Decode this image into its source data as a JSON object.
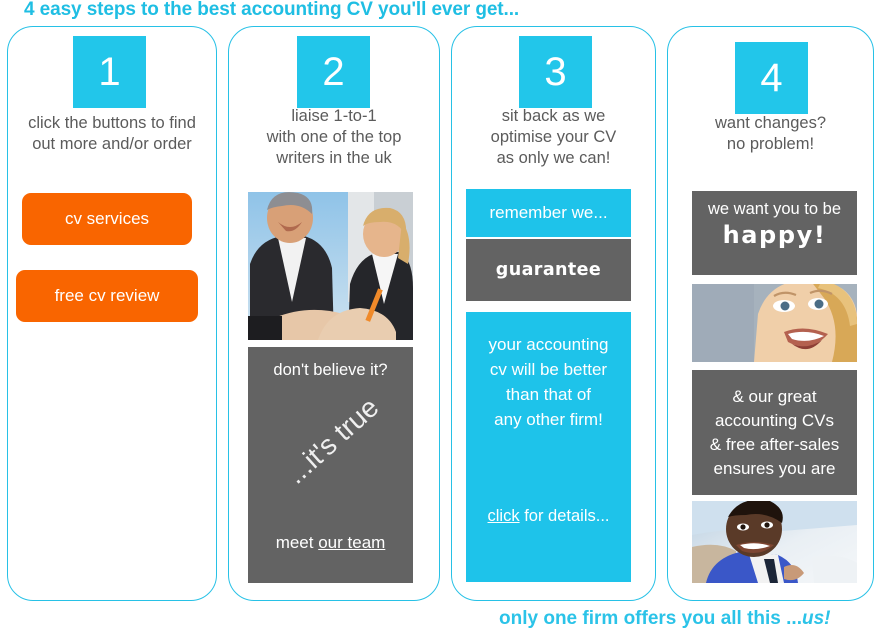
{
  "headline": "4 easy steps to the best accounting CV you'll ever get...",
  "footer": {
    "text": "only one firm offers you all this ...",
    "emphasis": "us!"
  },
  "colors": {
    "cyan": "#22C6EA",
    "cyan_border": "#27C1E6",
    "orange": "#F96500",
    "grey": "#636363",
    "caption_grey": "#5B5B5B"
  },
  "steps": [
    {
      "number": "1",
      "caption_line1": "click the buttons to find",
      "caption_line2": "out more and/or order",
      "buttons": [
        {
          "label": "cv services"
        },
        {
          "label": "free cv review"
        }
      ]
    },
    {
      "number": "2",
      "caption_line1": "liaise 1-to-1",
      "caption_line2": "with one of the top",
      "caption_line3": "writers in the uk",
      "photo_alt": "two colleagues reviewing a document",
      "block": {
        "top": "don't believe it?",
        "diagonal": "...it's true",
        "bottom_prefix": "meet ",
        "bottom_link": "our team"
      }
    },
    {
      "number": "3",
      "caption_line1": "sit back as we",
      "caption_line2": "optimise your CV",
      "caption_line3": "as only we can!",
      "remember_label": "remember we...",
      "guarantee_label": "guarantee",
      "promise_line1": "your accounting",
      "promise_line2": "cv will be better",
      "promise_line3": "than that of",
      "promise_line4": "any other firm!",
      "click_link": "click",
      "click_rest": " for details..."
    },
    {
      "number": "4",
      "caption_line1": "want changes?",
      "caption_line2": "no problem!",
      "happy_top": "we want you to be",
      "happy_big": "happy!",
      "photo_smile_alt": "smiling blonde woman",
      "great_line1": "& our great",
      "great_line2": "accounting CVs",
      "great_line3": "& free after-sales",
      "great_line4": "ensures you are",
      "photo_man_alt": "smiling man in blue shirt"
    }
  ]
}
